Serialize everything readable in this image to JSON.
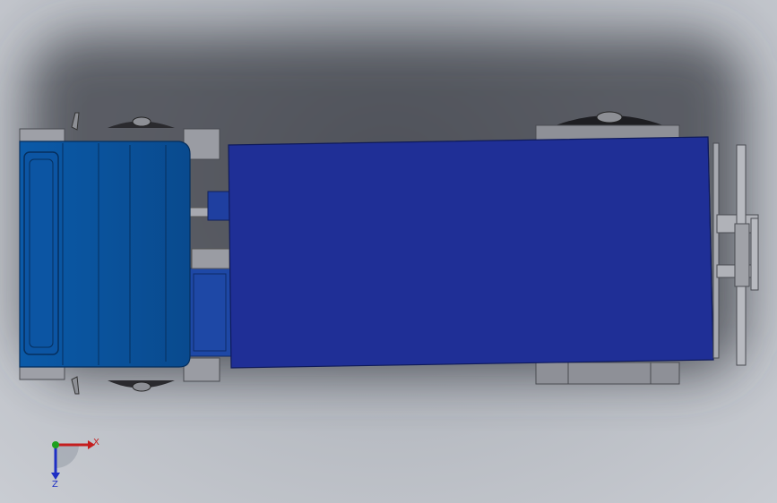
{
  "colors": {
    "cab_blue": "#0a4f9c",
    "cargo_blue": "#1f2f96",
    "chassis_grey": "#9a9ca3",
    "wheel_dark": "#2a2a2e",
    "axis_x": "#c41e1e",
    "axis_y": "#1ea01e",
    "axis_z": "#1e2fc4"
  },
  "model": {
    "parts": [
      "cab",
      "cargo-box",
      "chassis",
      "front-wheels",
      "rear-wheels",
      "rear-hitch"
    ]
  },
  "triad": {
    "x_label": "X",
    "z_label": "Z"
  }
}
